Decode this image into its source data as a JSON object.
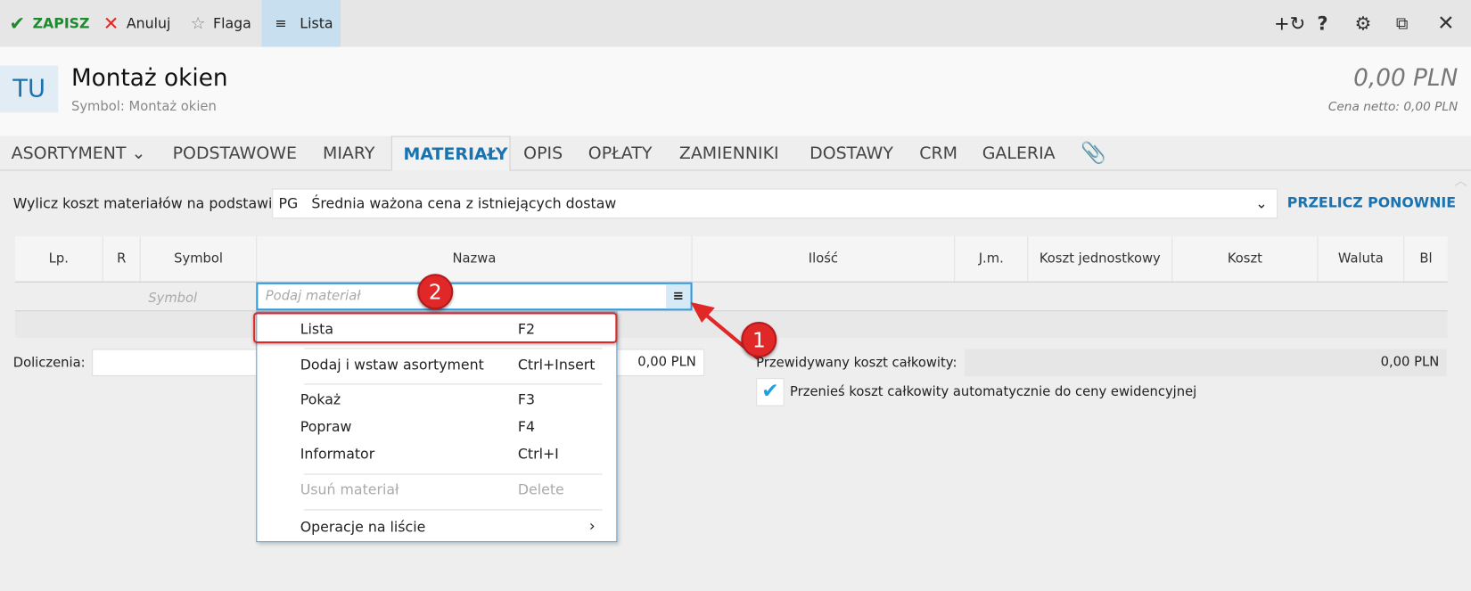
{
  "toolbar": {
    "save": "ZAPISZ",
    "cancel": "Anuluj",
    "flag": "Flaga",
    "list": "Lista"
  },
  "header": {
    "avatar": "TU",
    "title": "Montaż okien",
    "symbol": "Symbol: Montaż okien",
    "price": "0,00 PLN",
    "net_price": "Cena netto: 0,00 PLN"
  },
  "tabs": [
    "ASORTYMENT",
    "PODSTAWOWE",
    "MIARY",
    "MATERIAŁY",
    "OPIS",
    "OPŁATY",
    "ZAMIENNIKI",
    "DOSTAWY",
    "CRM",
    "GALERIA"
  ],
  "calc": {
    "label": "Wylicz koszt materiałów na podstawie:",
    "code": "PG",
    "value": "Średnia ważona cena z istniejących dostaw",
    "button": "PRZELICZ PONOWNIE"
  },
  "table": {
    "columns": [
      "Lp.",
      "R",
      "Symbol",
      "Nazwa",
      "Ilość",
      "J.m.",
      "Koszt jednostkowy",
      "Koszt",
      "Waluta",
      "Bl"
    ],
    "symbol_placeholder": "Symbol",
    "name_placeholder": "Podaj materiał"
  },
  "footer": {
    "extra_label": "Doliczenia:",
    "extra_value": "0,00 PLN",
    "total_label": "Przewidywany koszt całkowity:",
    "total_value": "0,00 PLN",
    "auto_transfer": "Przenieś koszt całkowity automatycznie do ceny ewidencyjnej",
    "auto_transfer_checked": true
  },
  "menu": [
    {
      "label": "Lista",
      "key": "F2"
    },
    {
      "label": "Dodaj i wstaw asortyment",
      "key": "Ctrl+Insert"
    },
    {
      "label": "Pokaż",
      "key": "F3"
    },
    {
      "label": "Popraw",
      "key": "F4"
    },
    {
      "label": "Informator",
      "key": "Ctrl+I"
    },
    {
      "label": "Usuń materiał",
      "key": "Delete",
      "disabled": true
    },
    {
      "label": "Operacje na liście",
      "submenu": "›"
    }
  ],
  "annotations": [
    "1",
    "2"
  ],
  "colors": {
    "accent": "#1a73b0",
    "save": "#1e8a2e",
    "annotation": "#e02828"
  }
}
